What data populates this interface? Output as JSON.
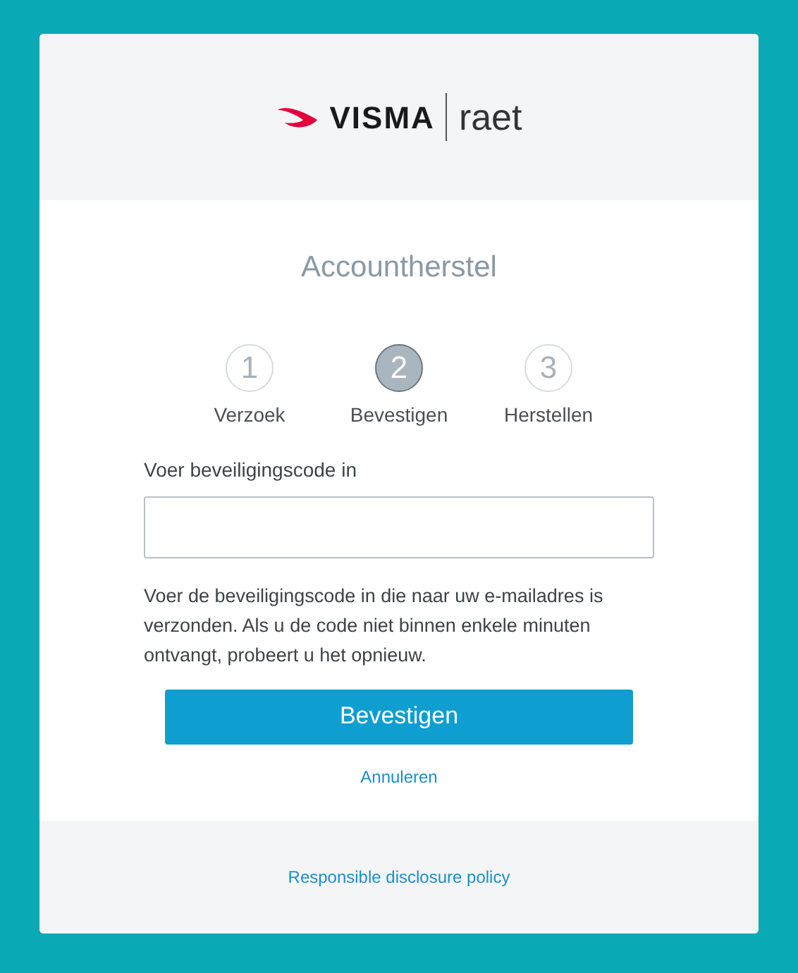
{
  "logo": {
    "brand": "VISMA",
    "product": "raet"
  },
  "title": "Accountherstel",
  "steps": [
    {
      "number": "1",
      "label": "Verzoek",
      "selected": false
    },
    {
      "number": "2",
      "label": "Bevestigen",
      "selected": true
    },
    {
      "number": "3",
      "label": "Herstellen",
      "selected": false
    }
  ],
  "field": {
    "label": "Voer beveiligingscode in"
  },
  "help": "Voer de beveiligingscode in die naar uw e-mailadres is verzonden. Als u de code niet binnen enkele minuten ontvangt, probeert u het opnieuw.",
  "confirm_button": "Bevestigen",
  "cancel_link": "Annuleren",
  "footer_link": "Responsible disclosure policy"
}
